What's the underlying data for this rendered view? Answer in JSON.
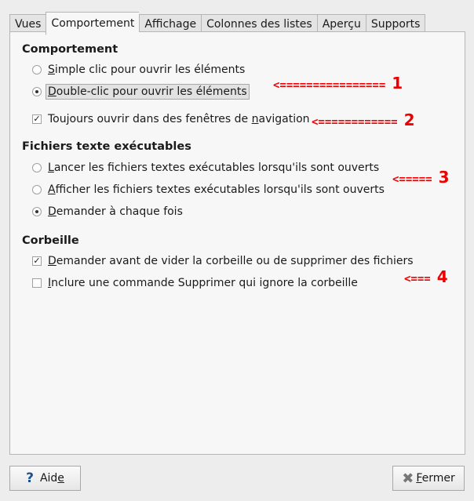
{
  "tabs": [
    "Vues",
    "Comportement",
    "Affichage",
    "Colonnes des listes",
    "Aperçu",
    "Supports"
  ],
  "active_tab": "Comportement",
  "sections": {
    "behavior": {
      "title": "Comportement",
      "single": {
        "k": "S",
        "post": "imple clic pour ouvrir les éléments",
        "checked": false
      },
      "double": {
        "k": "D",
        "post": "ouble-clic pour ouvrir les éléments",
        "checked": true
      },
      "nav": {
        "pre": "Toujours ouvrir dans des fenêtres de ",
        "k": "n",
        "post": "avigation",
        "checked": true
      }
    },
    "exec": {
      "title": "Fichiers texte exécutables",
      "launch": {
        "k": "L",
        "post": "ancer les fichiers textes exécutables lorsqu'ils sont ouverts",
        "checked": false
      },
      "show": {
        "k": "A",
        "post": "fficher les fichiers textes exécutables lorsqu'ils sont ouverts",
        "checked": false
      },
      "ask": {
        "k": "D",
        "post": "emander à chaque fois",
        "checked": true
      }
    },
    "trash": {
      "title": "Corbeille",
      "confirm": {
        "k": "D",
        "post": "emander avant de vider la corbeille ou de supprimer des fichiers",
        "checked": true
      },
      "delete": {
        "k": "I",
        "post": "nclure une commande Supprimer qui ignore la corbeille",
        "checked": false
      }
    }
  },
  "annotations": [
    {
      "arrow": "<================",
      "n": "1"
    },
    {
      "arrow": "<============",
      "n": "2"
    },
    {
      "arrow": "<=====",
      "n": "3"
    },
    {
      "arrow": "<===",
      "n": "4"
    }
  ],
  "buttons": {
    "help": {
      "pre": "Aid",
      "k": "e",
      "icon": "help-icon"
    },
    "close": {
      "k": "F",
      "post": "ermer",
      "icon": "close-icon"
    }
  },
  "colors": {
    "annotation": "#ee0000"
  }
}
